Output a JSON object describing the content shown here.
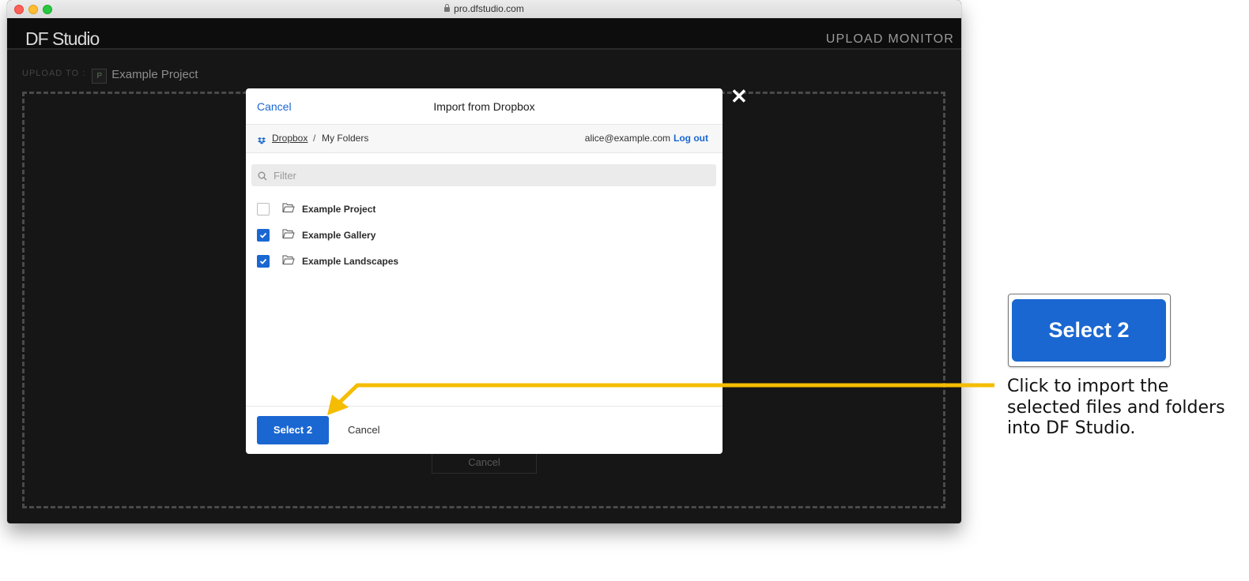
{
  "browser": {
    "url": "pro.dfstudio.com"
  },
  "app": {
    "logo": "DF Studio",
    "upload_monitor_label": "UPLOAD MONITOR",
    "upload_to_label": "UPLOAD TO :",
    "project_badge": "P",
    "project_name": "Example Project",
    "behind_cancel_label": "Cancel",
    "close_icon": "✕"
  },
  "modal": {
    "cancel_label": "Cancel",
    "title": "Import from Dropbox",
    "breadcrumb": {
      "root": "Dropbox",
      "separator": "/",
      "current": "My Folders"
    },
    "account_email": "alice@example.com",
    "account_separator": "·",
    "logout_label": "Log out",
    "filter_placeholder": "Filter",
    "items": [
      {
        "label": "Example Project",
        "checked": false
      },
      {
        "label": "Example Gallery",
        "checked": true
      },
      {
        "label": "Example Landscapes",
        "checked": true
      }
    ],
    "select_button_label": "Select 2",
    "footer_cancel_label": "Cancel"
  },
  "callout": {
    "button_label": "Select 2",
    "text": "Click to import the selected files and folders into DF Studio."
  },
  "colors": {
    "accent_blue": "#1a67d2",
    "arrow_yellow": "#f5bd02"
  }
}
